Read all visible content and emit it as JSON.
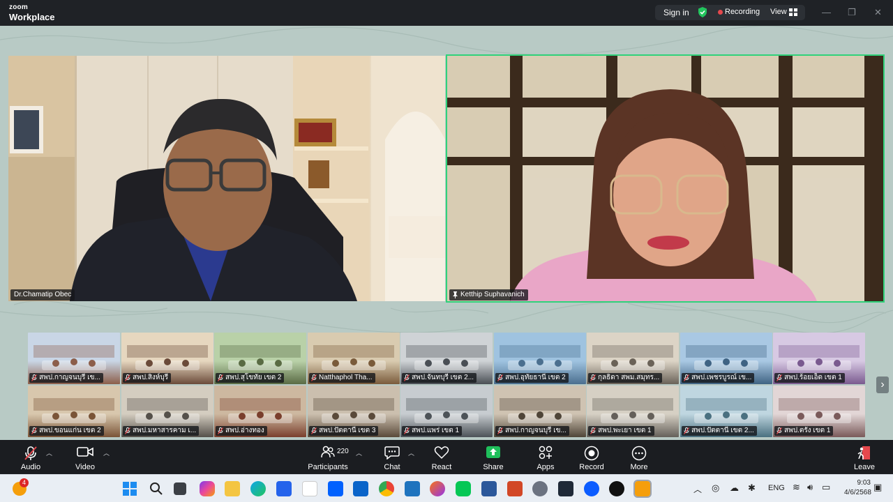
{
  "titlebar": {
    "logo_line1": "zoom",
    "logo_line2": "Workplace",
    "signin": "Sign in",
    "recording": "Recording",
    "view": "View"
  },
  "colors": {
    "accent_active_speaker": "#2fd27a",
    "recording_dot": "#e5484d",
    "share_button": "#1fbf5b",
    "mute_red": "#e5484d"
  },
  "main_videos": [
    {
      "name": "Dr.Chamatip Obec",
      "pinned": false
    },
    {
      "name": "Ketthip Suphavanich",
      "pinned": true
    }
  ],
  "gallery": [
    "สพป.กาญจนบุรี เข...",
    "สพป.สิงห์บุรี",
    "สพป.สุโขทัย เขต 2",
    "Natthaphol Tha...",
    "สพป.จันทบุรี เขต 2...",
    "สพป.อุทัยธานี เขต 2",
    "กุลธิดา สพม.สมุทร...",
    "สพป.เพชรบูรณ์ เข...",
    "สพป.ร้อยเอ็ด เขต 1",
    "สพป.ขอนแก่น เขต 2",
    "สพป.มหาสารคาม เ...",
    "สพป.อ่างทอง",
    "สพป.ปัตตานี เขต 3",
    "สพป.แพร่ เขต 1",
    "สพป.กาญจนบุรี เข...",
    "สพป.พะเยา เขต 1",
    "สพป.ปัตตานี เขต 2...",
    "สพป.ตรัง เขต 1"
  ],
  "controls": {
    "audio": "Audio",
    "video": "Video",
    "participants": "Participants",
    "participants_count": "220",
    "chat": "Chat",
    "react": "React",
    "share": "Share",
    "apps": "Apps",
    "record": "Record",
    "more": "More",
    "leave": "Leave"
  },
  "taskbar": {
    "notification_badge": "4",
    "language": "ENG",
    "time": "9:03",
    "date": "4/6/2568"
  }
}
